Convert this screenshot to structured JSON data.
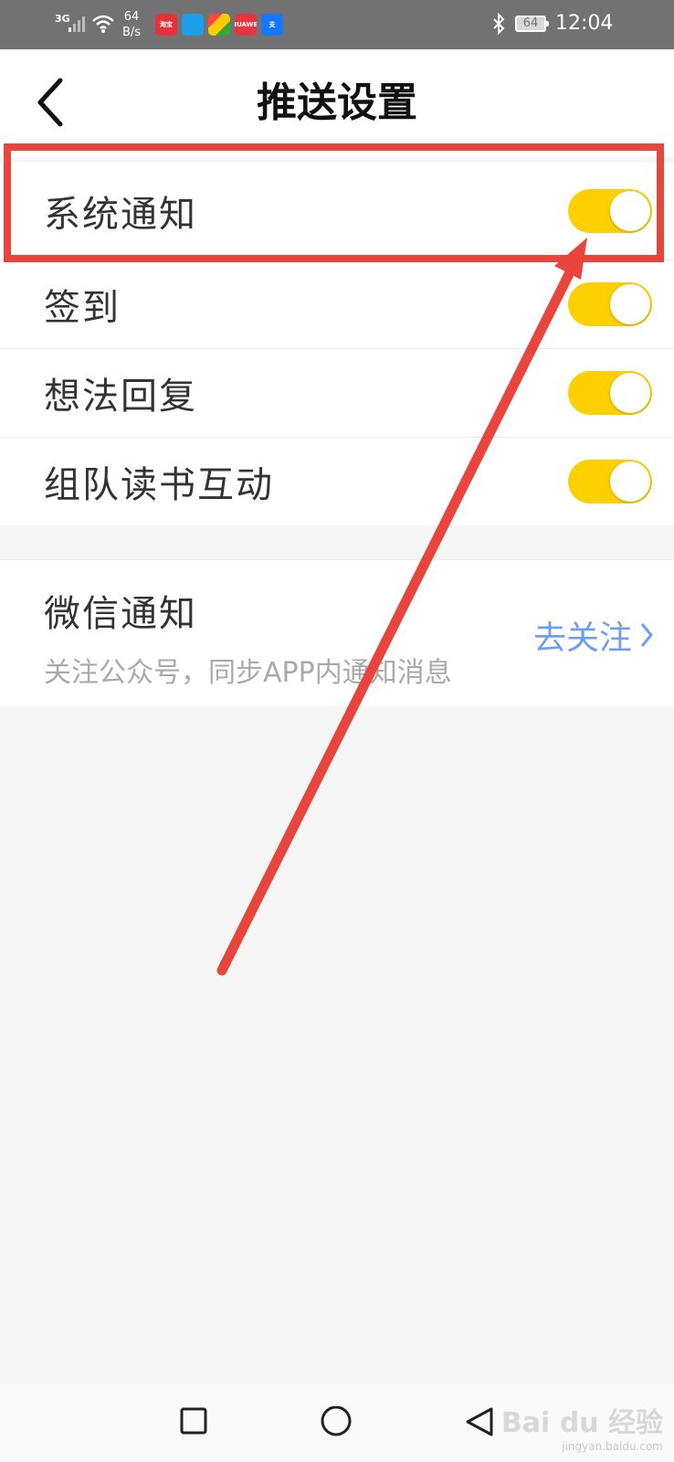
{
  "status_bar": {
    "network": "3G",
    "speed_value": "64",
    "speed_unit": "B/s",
    "battery": "64",
    "time": "12:04",
    "apps": [
      {
        "name": "ecommerce-app-icon",
        "color": "#e8303d",
        "label": "淘宝"
      },
      {
        "name": "lightbulb-app-icon",
        "color": "#1aa0e8",
        "label": ""
      },
      {
        "name": "colorful-app-icon",
        "color": "#ffffff",
        "label": ""
      },
      {
        "name": "huawei-app-icon",
        "color": "#e8343f",
        "label": "HUAWEI"
      },
      {
        "name": "alipay-app-icon",
        "color": "#1677ff",
        "label": "支"
      }
    ]
  },
  "header": {
    "title": "推送设置"
  },
  "settings": {
    "items": [
      {
        "label": "系统通知",
        "enabled": true
      },
      {
        "label": "签到",
        "enabled": true
      },
      {
        "label": "想法回复",
        "enabled": true
      },
      {
        "label": "组队读书互动",
        "enabled": true
      }
    ]
  },
  "wechat": {
    "title": "微信通知",
    "subtitle": "关注公众号，同步APP内通知消息",
    "action": "去关注"
  },
  "watermark": {
    "logo": "Bai du 经验",
    "url": "jingyan.baidu.com"
  },
  "colors": {
    "toggle_on": "#ffd000",
    "link": "#6e9ff0",
    "annotation": "#e8453c"
  }
}
